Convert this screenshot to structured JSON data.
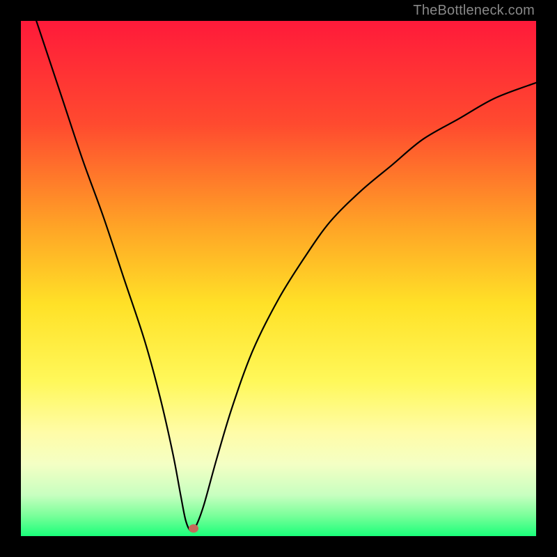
{
  "attribution": "TheBottleneck.com",
  "chart_data": {
    "type": "line",
    "title": "",
    "xlabel": "",
    "ylabel": "",
    "xlim": [
      0,
      100
    ],
    "ylim": [
      0,
      100
    ],
    "gradient_stops": [
      {
        "offset": 0,
        "color": "#ff1a3a"
      },
      {
        "offset": 0.2,
        "color": "#ff4a2f"
      },
      {
        "offset": 0.4,
        "color": "#ffa426"
      },
      {
        "offset": 0.55,
        "color": "#ffe127"
      },
      {
        "offset": 0.7,
        "color": "#fff85a"
      },
      {
        "offset": 0.8,
        "color": "#fffca8"
      },
      {
        "offset": 0.86,
        "color": "#f4ffc4"
      },
      {
        "offset": 0.92,
        "color": "#c8ffc0"
      },
      {
        "offset": 0.96,
        "color": "#7aff9a"
      },
      {
        "offset": 1.0,
        "color": "#1aff7a"
      }
    ],
    "series": [
      {
        "name": "bottleneck-curve",
        "x": [
          3,
          5,
          8,
          12,
          16,
          20,
          24,
          27,
          29.5,
          31,
          32,
          33,
          34,
          35.5,
          38,
          41,
          45,
          50,
          55,
          60,
          66,
          72,
          78,
          85,
          92,
          100
        ],
        "y": [
          100,
          94,
          85,
          73,
          62,
          50,
          38,
          27,
          16,
          8,
          3,
          1,
          2,
          6,
          15,
          25,
          36,
          46,
          54,
          61,
          67,
          72,
          77,
          81,
          85,
          88
        ]
      }
    ],
    "marker": {
      "x": 33.5,
      "y": 1.5,
      "color": "#c56a5a"
    }
  }
}
